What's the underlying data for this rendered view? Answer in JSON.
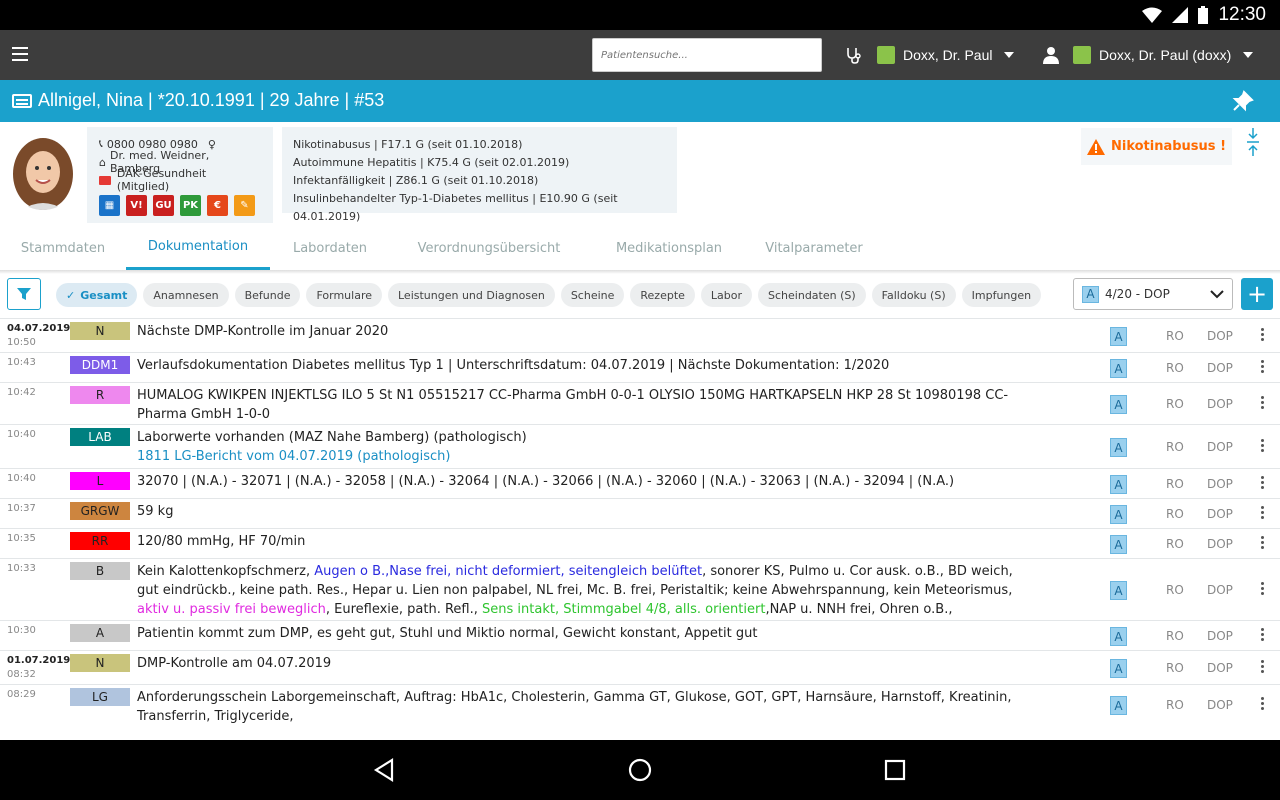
{
  "status": {
    "time": "12:30"
  },
  "topbar": {
    "search_placeholder": "Patientensuche...",
    "user1": "Doxx, Dr. Paul",
    "user2": "Doxx, Dr. Paul (doxx)"
  },
  "patient": {
    "title": "Allnigel, Nina | *20.10.1991 | 29 Jahre | #53",
    "phone": "0800 0980 0980",
    "gender_symbol": "♀",
    "doctor": "Dr. med. Weidner, Bamberg",
    "insurance": "DAK-Gesundheit (Mitglied)",
    "badges": [
      {
        "label": "▦",
        "color": "#1a73c9"
      },
      {
        "label": "V!",
        "color": "#c9201f"
      },
      {
        "label": "GU",
        "color": "#c9201f"
      },
      {
        "label": "PK",
        "color": "#2e9a3a"
      },
      {
        "label": "€",
        "color": "#e5471b"
      },
      {
        "label": "✎",
        "color": "#f39a17"
      }
    ],
    "diagnoses": [
      "Nikotinabusus | F17.1 G (seit 01.10.2018)",
      "Autoimmune Hepatitis | K75.4 G (seit 02.01.2019)",
      "Infektanfälligkeit | Z86.1 G (seit 01.10.2018)",
      "Insulinbehandelter Typ-1-Diabetes mellitus | E10.90 G (seit 04.01.2019)"
    ],
    "warning": "Nikotinabusus !"
  },
  "tabs": [
    "Stammdaten",
    "Dokumentation",
    "Labordaten",
    "Verordnungsübersicht",
    "Medikationsplan",
    "Vitalparameter"
  ],
  "filters": {
    "chips": [
      "Gesamt",
      "Anamnesen",
      "Befunde",
      "Formulare",
      "Leistungen und Diagnosen",
      "Scheine",
      "Rezepte",
      "Labor",
      "Scheindaten (S)",
      "Falldoku (S)",
      "Impfungen"
    ],
    "select_badge": "A",
    "select_value": "4/20 - DOP"
  },
  "rows": [
    {
      "date": "04.07.2019",
      "time": "10:50",
      "tag": "N",
      "tag_color": "#c9c47c",
      "text": "Nächste DMP-Kontrolle im Januar 2020",
      "l2": "",
      "badge": "A",
      "ro": "RO",
      "dop": "DOP"
    },
    {
      "date": "",
      "time": "10:43",
      "tag": "DDM1",
      "tag_color": "#7d5ce8",
      "tag_text_color": "#fff",
      "text": "Verlaufsdokumentation Diabetes mellitus Typ 1 | Unterschriftsdatum: 04.07.2019 | Nächste Dokumentation: 1/2020",
      "l2": "",
      "badge": "A",
      "ro": "RO",
      "dop": "DOP"
    },
    {
      "date": "",
      "time": "10:42",
      "tag": "R",
      "tag_color": "#ee88ee",
      "text": "HUMALOG KWIKPEN INJEKTLSG ILO 5 St N1 05515217 CC-Pharma GmbH 0-0-1 OLYSIO 150MG HARTKAPSELN HKP 28 St 10980198 CC-Pharma GmbH 1-0-0",
      "l2": "",
      "badge": "A",
      "ro": "RO",
      "dop": "DOP"
    },
    {
      "date": "",
      "time": "10:40",
      "tag": "LAB",
      "tag_color": "#008080",
      "tag_text_color": "#fff",
      "text": "Laborwerte vorhanden (MAZ Nahe Bamberg) (pathologisch)",
      "l2": "1811 LG-Bericht vom 04.07.2019 (pathologisch)",
      "badge": "A",
      "ro": "RO",
      "dop": "DOP"
    },
    {
      "date": "",
      "time": "10:40",
      "tag": "L",
      "tag_color": "#ff00ff",
      "text": "32070 | (N.A.) - 32071 | (N.A.) - 32058 | (N.A.) - 32064 | (N.A.) - 32066 | (N.A.) - 32060 | (N.A.) - 32063 | (N.A.) - 32094 | (N.A.)",
      "l2": "",
      "badge": "A",
      "ro": "RO",
      "dop": "DOP"
    },
    {
      "date": "",
      "time": "10:37",
      "tag": "GRGW",
      "tag_color": "#cd853f",
      "text": "59 kg",
      "l2": "",
      "badge": "A",
      "ro": "RO",
      "dop": "DOP"
    },
    {
      "date": "",
      "time": "10:35",
      "tag": "RR",
      "tag_color": "#ff0000",
      "text": "120/80 mmHg, HF 70/min",
      "l2": "",
      "badge": "A",
      "ro": "RO",
      "dop": "DOP"
    },
    {
      "date": "",
      "time": "10:33",
      "tag": "B",
      "tag_color": "#c8c8c8",
      "segments": [
        {
          "t": "Kein Kalottenkopfschmerz, ",
          "c": "#222"
        },
        {
          "t": "Augen o B.,Nase frei, nicht deformiert, seitengleich belüftet",
          "c": "#2a2adf"
        },
        {
          "t": ", sonorer KS, Pulmo u. Cor ausk. o.B., BD weich, gut eindrückb., keine path. Res., Hepar u. Lien non palpabel, NL frei, Mc. B. frei, Peristaltik; keine Abwehrspannung, kein Meteorismus, ",
          "c": "#222"
        },
        {
          "t": "aktiv u. passiv frei beweglich",
          "c": "#e02ae0"
        },
        {
          "t": ", Eureflexie, path. Refl., ",
          "c": "#222"
        },
        {
          "t": "Sens intakt, Stimmgabel 4/8, alls. orientiert",
          "c": "#2ec42e"
        },
        {
          "t": ",NAP u. NNH frei, Ohren o.B.,",
          "c": "#222"
        }
      ],
      "badge": "A",
      "ro": "RO",
      "dop": "DOP"
    },
    {
      "date": "",
      "time": "10:30",
      "tag": "A",
      "tag_color": "#c8c8c8",
      "text": "Patientin kommt zum DMP, es geht gut, Stuhl und Miktio normal, Gewicht konstant, Appetit gut",
      "l2": "",
      "badge": "A",
      "ro": "RO",
      "dop": "DOP"
    },
    {
      "date": "01.07.2019",
      "time": "08:32",
      "tag": "N",
      "tag_color": "#c9c47c",
      "text": "DMP-Kontrolle am 04.07.2019",
      "l2": "",
      "badge": "A",
      "ro": "RO",
      "dop": "DOP"
    },
    {
      "date": "",
      "time": "08:29",
      "tag": "LG",
      "tag_color": "#b0c4de",
      "text": "Anforderungsschein Laborgemeinschaft, Auftrag: HbA1c, Cholesterin, Gamma GT, Glukose, GOT, GPT, Harnsäure, Harnstoff, Kreatinin, Transferrin, Triglyceride,",
      "l2": "",
      "badge": "A",
      "ro": "RO",
      "dop": "DOP"
    }
  ]
}
